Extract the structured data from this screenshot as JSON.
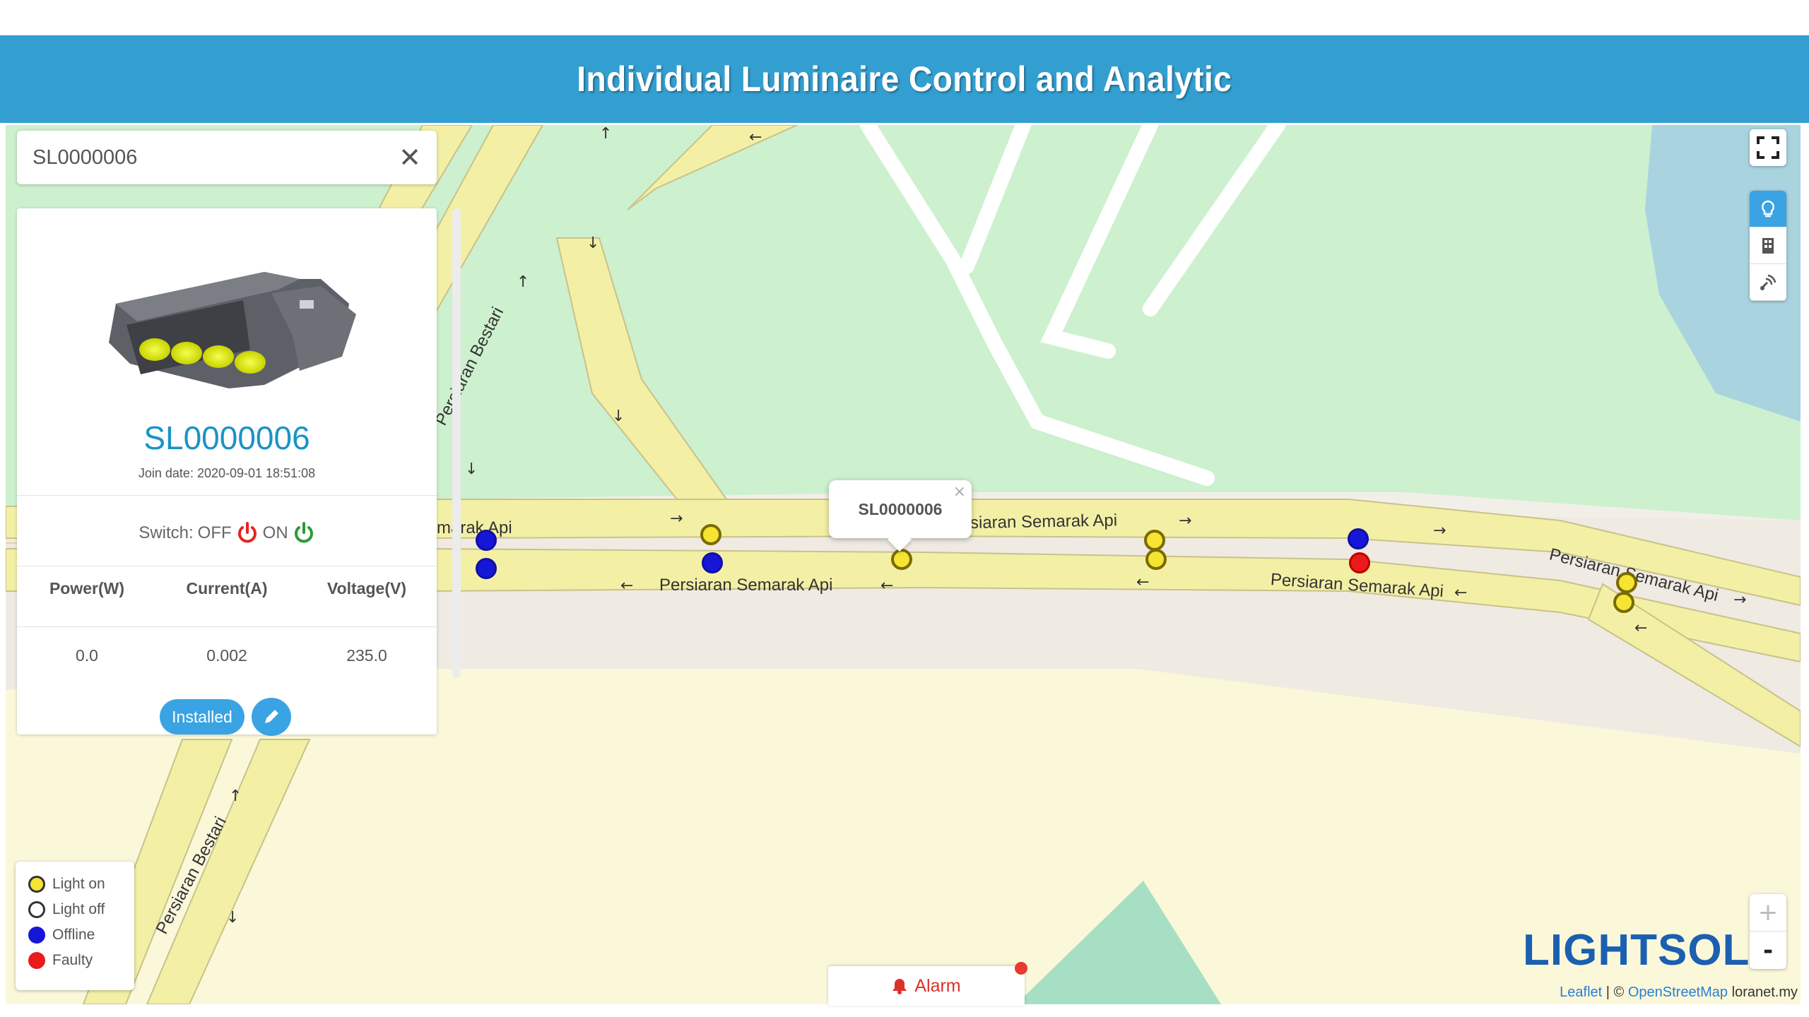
{
  "banner": {
    "title": "Individual Luminaire Control and Analytic"
  },
  "search": {
    "value": "SL0000006",
    "clear_icon": "close-icon"
  },
  "device_panel": {
    "device_id": "SL0000006",
    "join_date": "Join date: 2020-09-01 18:51:08",
    "switch_label": "Switch:",
    "off_label": "OFF",
    "on_label": "ON",
    "columns": [
      "Power(W)",
      "Current(A)",
      "Voltage(V)"
    ],
    "values": [
      "0.0",
      "0.002",
      "235.0"
    ],
    "status_button": "Installed",
    "edit_icon": "pencil-icon",
    "colors": {
      "off_power": "#e8231f",
      "on_power": "#2b9a38",
      "title": "#1a93c7",
      "button": "#3aa3e3"
    }
  },
  "popup": {
    "title": "SL0000006",
    "close": "×"
  },
  "streets": {
    "bestari_top": "Persiaran Bestari",
    "bestari_bottom": "Persiaran Bestari",
    "semarak_left": "marak Api",
    "semarak_center_bottom": "Persiaran Semarak Api",
    "semarak_center_top": "siaran Semarak Api",
    "semarak_right_bottom": "Persiaran Semarak Api",
    "semarak_far_right": "Persiaran Semarak Api"
  },
  "map_controls": {
    "fullscreen_icon": "fullscreen-icon",
    "layers": [
      "lightbulb-icon",
      "building-icon",
      "sensor-icon"
    ],
    "zoom_in": "+",
    "zoom_out": "-"
  },
  "legend": {
    "items": [
      {
        "label": "Light on",
        "status": "on"
      },
      {
        "label": "Light off",
        "status": "off"
      },
      {
        "label": "Offline",
        "status": "offline"
      },
      {
        "label": "Faulty",
        "status": "faulty"
      }
    ]
  },
  "markers": [
    {
      "id": "m1",
      "status": "offline"
    },
    {
      "id": "m2",
      "status": "offline"
    },
    {
      "id": "m3",
      "status": "on"
    },
    {
      "id": "m4",
      "status": "offline"
    },
    {
      "id": "m5",
      "status": "on"
    },
    {
      "id": "m6",
      "status": "on"
    },
    {
      "id": "m7",
      "status": "on"
    },
    {
      "id": "m8",
      "status": "offline"
    },
    {
      "id": "m9",
      "status": "faulty"
    },
    {
      "id": "m10",
      "status": "on"
    },
    {
      "id": "m11",
      "status": "on"
    }
  ],
  "alarm": {
    "label": "Alarm",
    "icon": "bell-icon"
  },
  "brand": {
    "logo_text": "LIGHTSOL",
    "color": "#1b5fb1"
  },
  "attribution": {
    "leaflet": "Leaflet",
    "separator": "| ©",
    "osm": "OpenStreetMap",
    "extra": "loranet.my"
  }
}
